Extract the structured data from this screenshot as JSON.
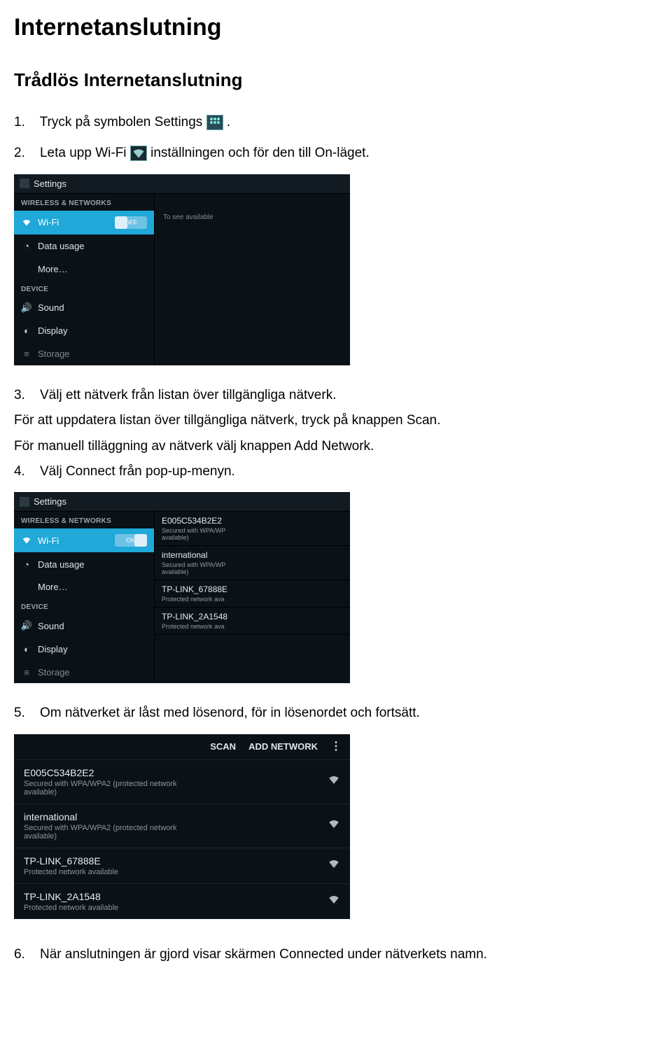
{
  "title": "Internetanslutning",
  "subtitle": "Trådlös Internetanslutning",
  "steps": {
    "s1a": "1.",
    "s1b": "Tryck på symbolen Settings",
    "s1c": ".",
    "s2a": "2.",
    "s2b": "Leta upp Wi-Fi",
    "s2c": "inställningen och för den till On-läget.",
    "s3a": "3.",
    "s3b": "Välj ett nätverk från listan över tillgängliga nätverk.",
    "s3c": "För att uppdatera listan över tillgängliga nätverk, tryck på knappen Scan.",
    "s3d": "För manuell tilläggning av nätverk välj knappen Add Network.",
    "s4a": "4.",
    "s4b": "Välj Connect från pop-up-menyn.",
    "s5a": "5.",
    "s5b": "Om nätverket är låst med lösenord, för in lösenordet och fortsätt.",
    "s6a": "6.",
    "s6b": "När anslutningen är gjord visar skärmen Connected under nätverkets namn."
  },
  "shot1": {
    "header": "Settings",
    "wireless_header": "WIRELESS & NETWORKS",
    "wifi": "Wi-Fi",
    "wifi_toggle": "OFF",
    "data_usage": "Data usage",
    "more": "More…",
    "device_header": "DEVICE",
    "sound": "Sound",
    "display": "Display",
    "storage": "Storage",
    "hint": "To see available"
  },
  "shot2": {
    "header": "Settings",
    "wireless_header": "WIRELESS & NETWORKS",
    "wifi": "Wi-Fi",
    "wifi_toggle": "ON",
    "data_usage": "Data usage",
    "more": "More…",
    "device_header": "DEVICE",
    "sound": "Sound",
    "display": "Display",
    "storage": "Storage",
    "networks": [
      {
        "name": "E005C534B2E2",
        "sub": "Secured with WPA/WP\navailable)"
      },
      {
        "name": "international",
        "sub": "Secured with WPA/WP\navailable)"
      },
      {
        "name": "TP-LINK_67888E",
        "sub": "Protected network ava"
      },
      {
        "name": "TP-LINK_2A1548",
        "sub": "Protected network ava"
      }
    ]
  },
  "shot3": {
    "scan": "SCAN",
    "add": "ADD NETWORK",
    "networks": [
      {
        "name": "E005C534B2E2",
        "sub": "Secured with WPA/WPA2 (protected network\navailable)"
      },
      {
        "name": "international",
        "sub": "Secured with WPA/WPA2 (protected network\navailable)"
      },
      {
        "name": "TP-LINK_67888E",
        "sub": "Protected network available"
      },
      {
        "name": "TP-LINK_2A1548",
        "sub": "Protected network available"
      }
    ]
  }
}
